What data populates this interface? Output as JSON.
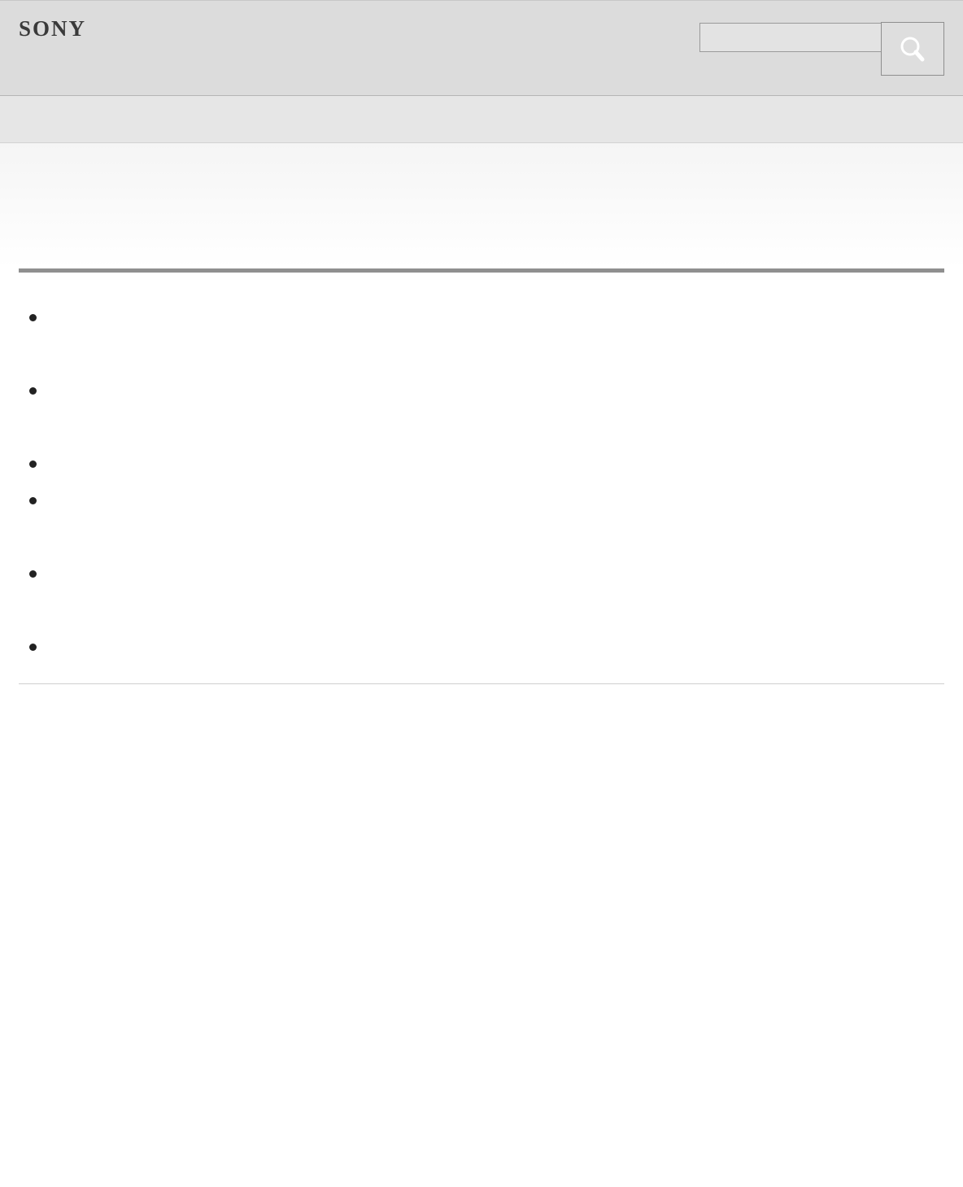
{
  "header": {
    "brand": "SONY",
    "search": {
      "value": "",
      "placeholder": ""
    },
    "search_button_icon": "magnifier-icon"
  },
  "nav": {
    "items": []
  },
  "page": {
    "title": "",
    "list_items": [
      "",
      "",
      "",
      "",
      "",
      ""
    ]
  }
}
